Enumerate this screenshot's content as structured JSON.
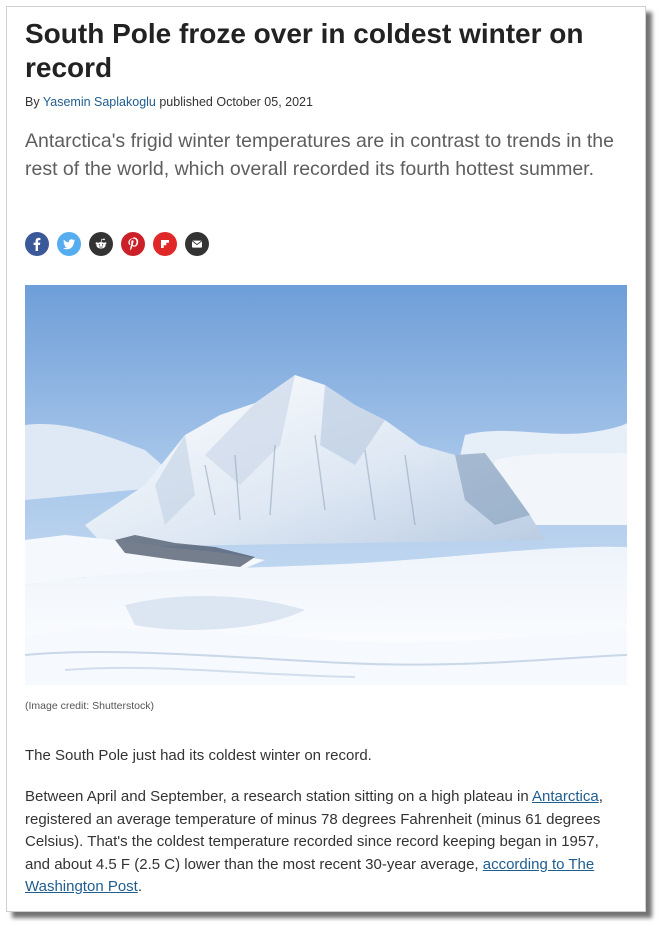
{
  "article": {
    "headline": "South Pole froze over in coldest winter on record",
    "byline": {
      "prefix": "By",
      "author": "Yasemin Saplakoglu",
      "published_label": "published",
      "date": "October 05, 2021"
    },
    "standfirst": "Antarctica's frigid winter temperatures are in contrast to trends in the rest of the world, which overall recorded its fourth hottest summer.",
    "share_buttons": [
      {
        "icon": "facebook-icon",
        "color": "#3b5998"
      },
      {
        "icon": "twitter-icon",
        "color": "#55acee"
      },
      {
        "icon": "reddit-icon",
        "color": "#333333"
      },
      {
        "icon": "pinterest-icon",
        "color": "#cb2027"
      },
      {
        "icon": "flipboard-icon",
        "color": "#e12828"
      },
      {
        "icon": "email-icon",
        "color": "#333333"
      }
    ],
    "image_credit": "(Image credit: Shutterstock)",
    "body": {
      "p1": "The South Pole just had its coldest winter on record.",
      "p2_a": "Between April and September, a research station sitting on a high plateau in ",
      "p2_link1": "Antarctica",
      "p2_b": ", registered an average temperature of minus 78 degrees Fahrenheit (minus 61 degrees Celsius). That's the coldest temperature recorded since record keeping began in 1957, and about 4.5 F (2.5 C) lower than the most recent 30-year average, ",
      "p2_link2": "according to The Washington Post",
      "p2_c": "."
    }
  }
}
